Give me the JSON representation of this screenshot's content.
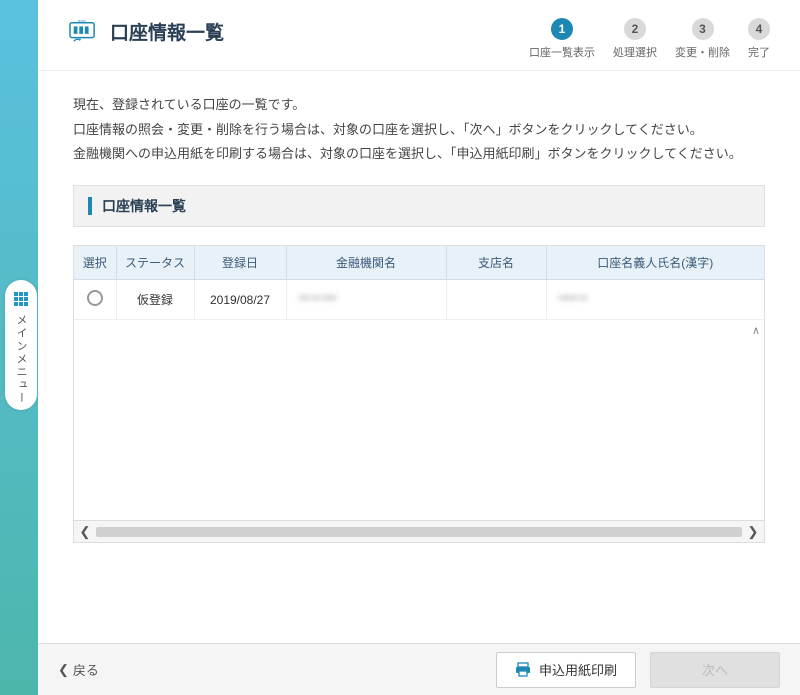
{
  "header": {
    "title": "口座情報一覧"
  },
  "steps": [
    {
      "num": "1",
      "label": "口座一覧表示",
      "active": true
    },
    {
      "num": "2",
      "label": "処理選択",
      "active": false
    },
    {
      "num": "3",
      "label": "変更・削除",
      "active": false
    },
    {
      "num": "4",
      "label": "完了",
      "active": false
    }
  ],
  "desc": {
    "line1": "現在、登録されている口座の一覧です。",
    "line2": "口座情報の照会・変更・削除を行う場合は、対象の口座を選択し、「次へ」ボタンをクリックしてください。",
    "line3": "金融機関への申込用紙を印刷する場合は、対象の口座を選択し、「申込用紙印刷」ボタンをクリックしてください。"
  },
  "section": {
    "title": "口座情報一覧"
  },
  "table": {
    "headers": {
      "select": "選択",
      "status": "ステータス",
      "date": "登録日",
      "bank": "金融機関名",
      "branch": "支店名",
      "holder": "口座名義人氏名(漢字)"
    },
    "rows": [
      {
        "status": "仮登録",
        "date": "2019/08/27",
        "bank": "*** ** ****",
        "branch": "",
        "holder": "***** **"
      }
    ]
  },
  "footer": {
    "back": "戻る",
    "print": "申込用紙印刷",
    "next": "次へ"
  },
  "side": {
    "label": "メインメニュー"
  }
}
